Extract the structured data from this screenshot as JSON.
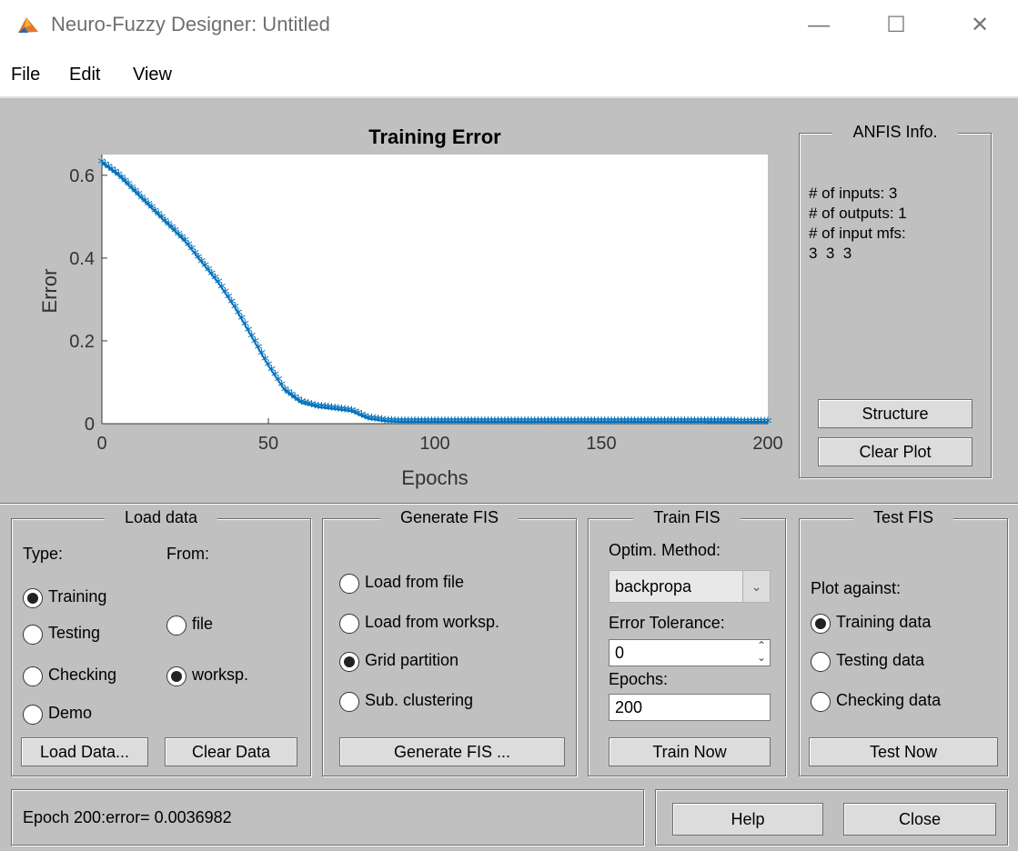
{
  "window": {
    "title": "Neuro-Fuzzy Designer: Untitled",
    "minimize": "—",
    "maximize": "☐",
    "close": "✕"
  },
  "menu": {
    "file": "File",
    "edit": "Edit",
    "view": "View"
  },
  "chart_data": {
    "type": "line",
    "title": "Training Error",
    "xlabel": "Epochs",
    "ylabel": "Error",
    "xlim": [
      0,
      200
    ],
    "ylim": [
      0,
      0.65
    ],
    "xticks": [
      "0",
      "50",
      "100",
      "150",
      "200"
    ],
    "yticks": [
      "0",
      "0.2",
      "0.4",
      "0.6"
    ],
    "marker": "*",
    "color": "#0072bd",
    "series": [
      {
        "x": [
          0,
          5,
          10,
          15,
          20,
          25,
          30,
          35,
          40,
          45,
          50,
          55,
          60,
          65,
          70,
          75,
          80,
          85,
          90,
          100,
          120,
          150,
          180,
          200
        ],
        "values": [
          0.63,
          0.6,
          0.56,
          0.52,
          0.48,
          0.44,
          0.39,
          0.34,
          0.28,
          0.21,
          0.14,
          0.08,
          0.05,
          0.04,
          0.035,
          0.03,
          0.012,
          0.006,
          0.004,
          0.004,
          0.004,
          0.004,
          0.004,
          0.0037
        ]
      }
    ]
  },
  "anfis_info": {
    "title": "ANFIS Info.",
    "inputs": "# of inputs: 3",
    "outputs": "# of outputs: 1",
    "input_mfs": "# of input mfs:",
    "mfs_values": "3  3  3",
    "structure_btn": "Structure",
    "clear_plot_btn": "Clear Plot"
  },
  "load_data": {
    "title": "Load data",
    "type_label": "Type:",
    "from_label": "From:",
    "type_options": [
      {
        "label": "Training",
        "selected": true
      },
      {
        "label": "Testing",
        "selected": false
      },
      {
        "label": "Checking",
        "selected": false
      },
      {
        "label": "Demo",
        "selected": false
      }
    ],
    "from_options": [
      {
        "label": "file",
        "selected": false
      },
      {
        "label": "worksp.",
        "selected": true
      }
    ],
    "load_btn": "Load Data...",
    "clear_btn": "Clear Data"
  },
  "generate_fis": {
    "title": "Generate FIS",
    "options": [
      {
        "label": "Load from file",
        "selected": false
      },
      {
        "label": "Load from worksp.",
        "selected": false
      },
      {
        "label": "Grid partition",
        "selected": true
      },
      {
        "label": "Sub. clustering",
        "selected": false
      }
    ],
    "generate_btn": "Generate FIS ..."
  },
  "train_fis": {
    "title": "Train FIS",
    "optim_label": "Optim. Method:",
    "optim_value": "backpropa",
    "tolerance_label": "Error Tolerance:",
    "tolerance_value": "0",
    "epochs_label": "Epochs:",
    "epochs_value": "200",
    "train_btn": "Train Now"
  },
  "test_fis": {
    "title": "Test FIS",
    "plot_label": "Plot against:",
    "options": [
      {
        "label": "Training data",
        "selected": true
      },
      {
        "label": "Testing data",
        "selected": false
      },
      {
        "label": "Checking data",
        "selected": false
      }
    ],
    "test_btn": "Test Now"
  },
  "status": {
    "text": "Epoch 200:error= 0.0036982"
  },
  "footer": {
    "help_btn": "Help",
    "close_btn": "Close"
  }
}
